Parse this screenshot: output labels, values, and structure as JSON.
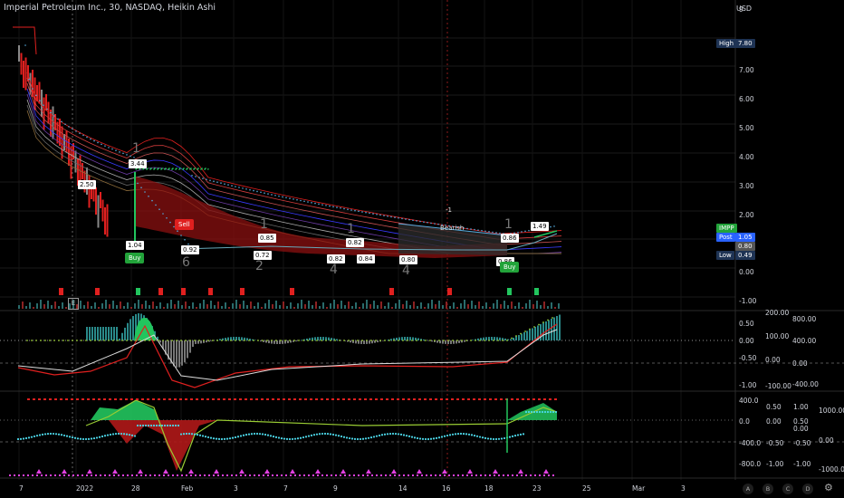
{
  "header": {
    "title": "Imperial Petroleum Inc., 30, NASDAQ, Heikin Ashi",
    "currency": "USD"
  },
  "price_axis": [
    "9",
    "8.00",
    "7.00",
    "6.00",
    "5.00",
    "4.00",
    "3.00",
    "2.00",
    "1.00",
    "0.00",
    "-1.00"
  ],
  "price_tags": {
    "high_label": "High",
    "high_value": "7.80",
    "symbol": "IMPP",
    "post_label": "Post",
    "post_value": "1.05",
    "last_value": "0.80",
    "low_label": "Low",
    "low_value": "0.49"
  },
  "osc1_axis_a": [
    "0.50",
    "0.00",
    "-0.50",
    "-1.00"
  ],
  "osc1_axis_b": [
    "200.00",
    "100.00",
    "0.00",
    "-100.00"
  ],
  "osc1_axis_c": [
    "800.00",
    "400.00",
    "0.00",
    "-400.00"
  ],
  "osc2_axis_a": [
    "400.0",
    "0.0",
    "-400.0",
    "-800.0"
  ],
  "osc2_axis_b": [
    "0.50",
    "0.00",
    "-0.50",
    "-1.00"
  ],
  "osc2_axis_c": [
    "1.00",
    "0.50",
    "0.00",
    "-0.50",
    "-1.00"
  ],
  "osc2_axis_d": [
    "1000.00",
    "0.00",
    "-1000.00"
  ],
  "time_axis": [
    "7",
    "2022",
    "28",
    "Feb",
    "3",
    "7",
    "9",
    "14",
    "16",
    "18",
    "23",
    "25",
    "Mar",
    "3"
  ],
  "price_markers": [
    "3.44",
    "2.50",
    "1.04",
    "0.92",
    "0.85",
    "0.72",
    "0.82",
    "0.82",
    "0.84",
    "0.80",
    "0.86",
    "1.49",
    "0.86"
  ],
  "signals": {
    "buy": "Buy",
    "sell": "Sell",
    "buy2": "Buy",
    "bearish": "Bearish",
    "bearish_count": "-1"
  },
  "wave_labels": [
    "1",
    "6",
    "1",
    "2",
    "1",
    "4",
    "4",
    "1"
  ],
  "e_box": "E",
  "footer_buttons": [
    "A",
    "B",
    "C",
    "D"
  ],
  "colors": {
    "background": "#000000",
    "up": "#22c55e",
    "down": "#e0201f",
    "accent": "#2962ff"
  }
}
